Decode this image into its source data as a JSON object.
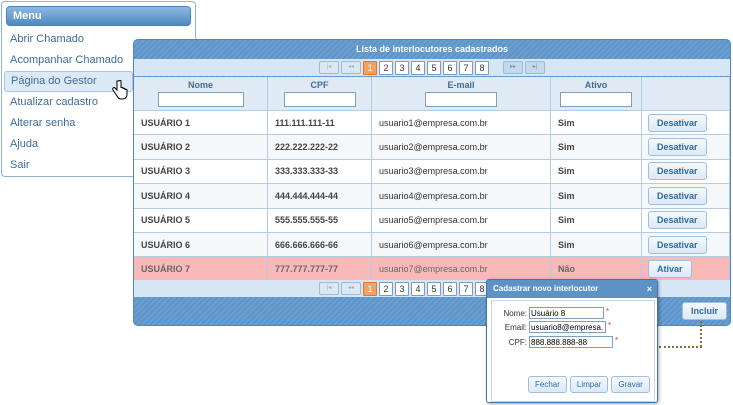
{
  "menu": {
    "title": "Menu",
    "items": [
      {
        "label": "Abrir Chamado"
      },
      {
        "label": "Acompanhar Chamado"
      },
      {
        "label": "Página do Gestor"
      },
      {
        "label": "Atualizar cadastro"
      },
      {
        "label": "Alterar senha"
      },
      {
        "label": "Ajuda"
      },
      {
        "label": "Sair"
      }
    ]
  },
  "panel": {
    "title": "Lista de interlocutores cadastrados",
    "pager": {
      "pages": [
        "1",
        "2",
        "3",
        "4",
        "5",
        "6",
        "7",
        "8"
      ],
      "active": "1",
      "first": "|◂",
      "prev": "◂◂",
      "next": "▸▸",
      "last": "▸|"
    },
    "columns": {
      "nome": "Nome",
      "cpf": "CPF",
      "email": "E-mail",
      "ativo": "Ativo"
    },
    "rows": [
      {
        "nome": "USUÁRIO 1",
        "cpf": "111.111.111-11",
        "email": "usuario1@empresa.com.br",
        "ativo": "Sim",
        "action": "Desativar"
      },
      {
        "nome": "USUÁRIO 2",
        "cpf": "222.222.222-22",
        "email": "usuario2@empresa.com.br",
        "ativo": "Sim",
        "action": "Desativar"
      },
      {
        "nome": "USUÁRIO 3",
        "cpf": "333.333.333-33",
        "email": "usuario3@empresa.com.br",
        "ativo": "Sim",
        "action": "Desativar"
      },
      {
        "nome": "USUÁRIO 4",
        "cpf": "444.444.444-44",
        "email": "usuario4@empresa.com.br",
        "ativo": "Sim",
        "action": "Desativar"
      },
      {
        "nome": "USUÁRIO 5",
        "cpf": "555.555.555-55",
        "email": "usuario5@empresa.com.br",
        "ativo": "Sim",
        "action": "Desativar"
      },
      {
        "nome": "USUÁRIO 6",
        "cpf": "666.666.666-66",
        "email": "usuario6@empresa.com.br",
        "ativo": "Sim",
        "action": "Desativar"
      },
      {
        "nome": "USUÁRIO 7",
        "cpf": "777.777.777-77",
        "email": "usuario7@empresa.com.br",
        "ativo": "Não",
        "action": "Ativar"
      }
    ],
    "include_label": "Incluir"
  },
  "modal": {
    "title": "Cadastrar novo interlocutor",
    "close": "×",
    "nome_label": "Nome:",
    "nome_value": "Usuário 8",
    "email_label": "Email:",
    "email_value": "usuario8@empresa.",
    "cpf_label": "CPF:",
    "cpf_value": "888.888.888-88",
    "required": "*",
    "buttons": {
      "close": "Fechar",
      "clear": "Limpar",
      "save": "Gravar"
    }
  },
  "colors": {
    "accent": "#5e94c8",
    "inactive_row": "#f9b9b9",
    "active_page": "#f4a261"
  },
  "icons": {
    "cursor": "hand-pointer-icon"
  }
}
